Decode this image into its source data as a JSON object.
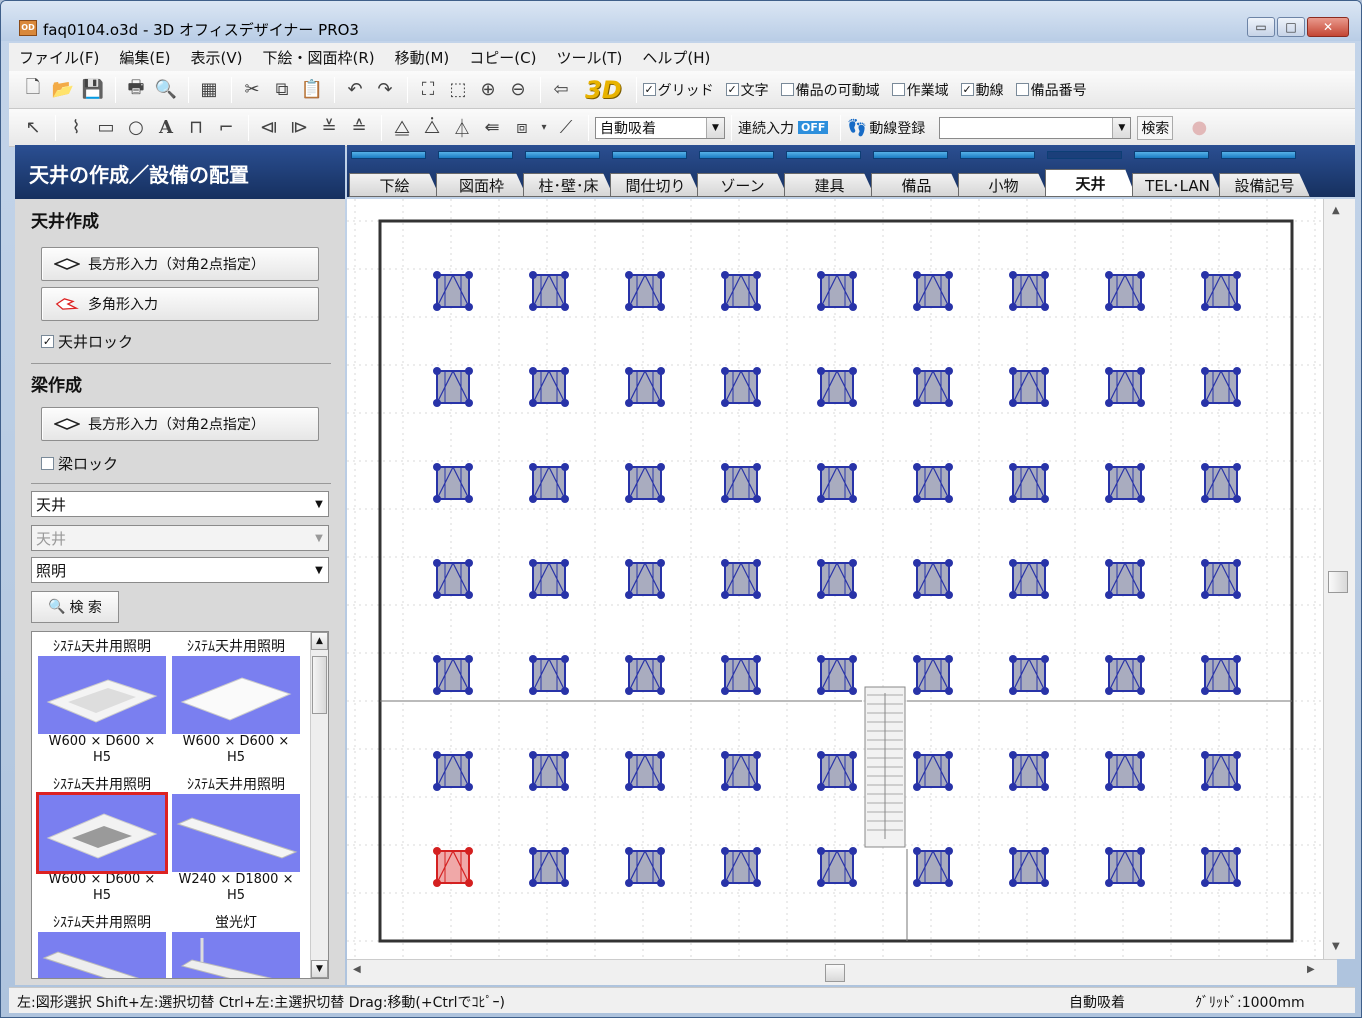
{
  "window": {
    "title": "faq0104.o3d - 3D オフィスデザイナー PRO3",
    "icon_text": "OD"
  },
  "window_buttons": {
    "minimize": "▭",
    "maximize": "□",
    "close": "✕"
  },
  "menu": [
    "ファイル(F)",
    "編集(E)",
    "表示(V)",
    "下絵・図面枠(R)",
    "移動(M)",
    "コピー(C)",
    "ツール(T)",
    "ヘルプ(H)"
  ],
  "toolbar1": {
    "three_d": "3D",
    "checks": [
      {
        "label": "グリッド",
        "checked": true
      },
      {
        "label": "文字",
        "checked": true
      },
      {
        "label": "備品の可動域",
        "checked": false
      },
      {
        "label": "作業域",
        "checked": false
      },
      {
        "label": "動線",
        "checked": true
      },
      {
        "label": "備品番号",
        "checked": false
      }
    ]
  },
  "toolbar2": {
    "snap_mode": "自動吸着",
    "continuous_label": "連続入力",
    "continuous_state": "OFF",
    "path_register": "動線登録",
    "search_value": "",
    "search_label": "検索"
  },
  "left_panel": {
    "header": "天井の作成／設備の配置",
    "ceiling_section": "天井作成",
    "rect_button": "長方形入力（対角2点指定）",
    "poly_button": "多角形入力",
    "ceiling_lock": {
      "label": "天井ロック",
      "checked": true
    },
    "beam_section": "梁作成",
    "beam_rect_button": "長方形入力（対角2点指定）",
    "beam_lock": {
      "label": "梁ロック",
      "checked": false
    },
    "combo1": "天井",
    "combo2": "天井",
    "combo3": "照明",
    "search_button": "検 索",
    "catalog": [
      {
        "name": "ｼｽﾃﾑ天井用照明",
        "size": "W600 × D600 ×",
        "size2": "H5"
      },
      {
        "name": "ｼｽﾃﾑ天井用照明",
        "size": "W600 × D600 ×",
        "size2": "H5"
      },
      {
        "name": "ｼｽﾃﾑ天井用照明",
        "size": "W600 × D600 ×",
        "size2": "H5"
      },
      {
        "name": "ｼｽﾃﾑ天井用照明",
        "size": "W240 × D1800 ×",
        "size2": "H5"
      },
      {
        "name": "ｼｽﾃﾑ天井用照明",
        "size": "",
        "size2": ""
      },
      {
        "name": "蛍光灯",
        "size": "",
        "size2": ""
      }
    ],
    "selected_index": 2
  },
  "tabs": [
    "下絵",
    "図面枠",
    "柱･壁･床",
    "間仕切り",
    "ゾーン",
    "建具",
    "備品",
    "小物",
    "天井",
    "TEL･LAN",
    "設備記号"
  ],
  "active_tab": "天井",
  "fixtures": {
    "rows": 7,
    "cols": 9,
    "selected": {
      "row": 6,
      "col": 0
    }
  },
  "status": {
    "hint": "左:図形選択 Shift+左:選択切替 Ctrl+左:主選択切替 Drag:移動(+Ctrlでｺﾋﾟｰ)",
    "snap": "自動吸着",
    "grid": "ｸﾞﾘｯﾄﾞ:1000mm"
  },
  "colors": {
    "accent": "#16305f",
    "fixture": "#2833a8",
    "fixture_selected": "#d42020",
    "catalog_bg": "#7a7ff0"
  }
}
